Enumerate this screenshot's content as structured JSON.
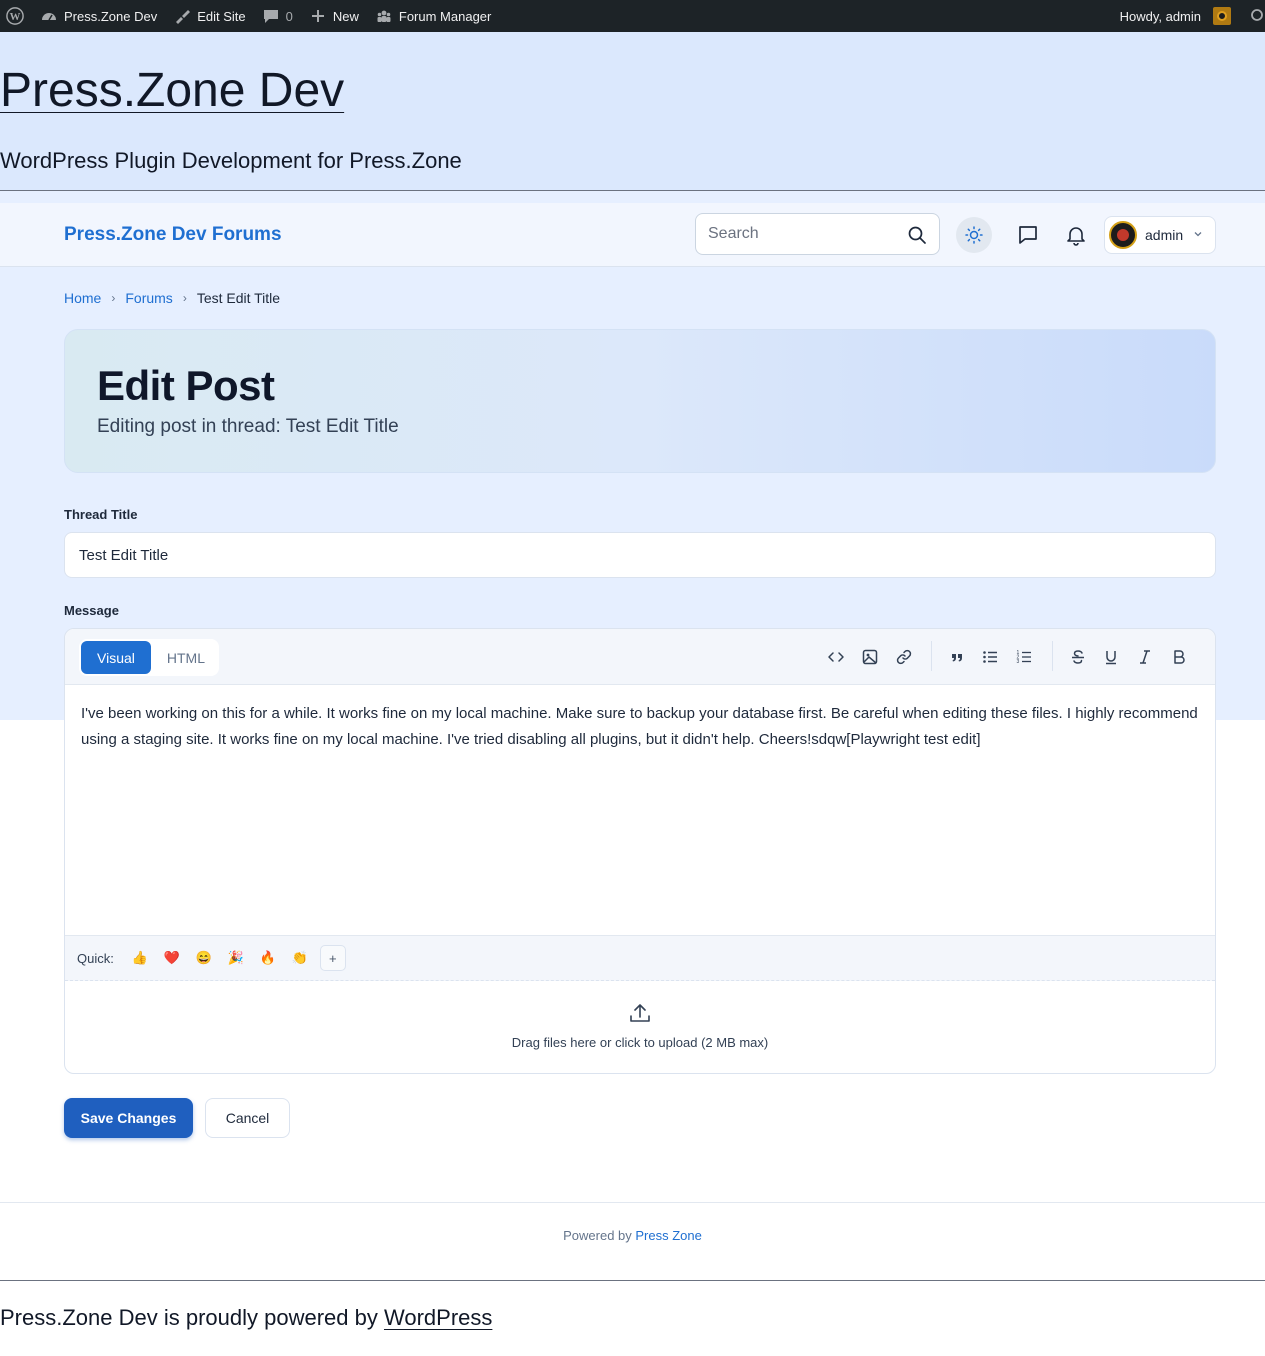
{
  "adminbar": {
    "site_name": "Press.Zone Dev",
    "edit_site": "Edit Site",
    "comments_count": "0",
    "new_label": "New",
    "forum_manager": "Forum Manager",
    "howdy": "Howdy, admin"
  },
  "site": {
    "title": "Press.Zone Dev",
    "description": "WordPress Plugin Development for Press.Zone"
  },
  "forum_header": {
    "brand": "Press.Zone Dev Forums",
    "search_placeholder": "Search",
    "user_name": "admin"
  },
  "breadcrumb": {
    "home": "Home",
    "forums": "Forums",
    "current": "Test Edit Title",
    "separator": "›"
  },
  "hero": {
    "title": "Edit Post",
    "subtitle": "Editing post in thread: Test Edit Title"
  },
  "form": {
    "thread_title_label": "Thread Title",
    "thread_title_value": "Test Edit Title",
    "message_label": "Message",
    "tabs": [
      "Visual",
      "HTML"
    ],
    "active_tab": "Visual",
    "body": "I've been working on this for a while. It works fine on my local machine. Make sure to backup your database first. Be careful when editing these files. I highly recommend using a staging site. It works fine on my local machine. I've tried disabling all plugins, but it didn't help. Cheers!sdqw[Playwright test edit]",
    "quick_label": "Quick:",
    "quick_emojis": [
      "👍",
      "❤️",
      "😄",
      "🎉",
      "🔥",
      "👏"
    ],
    "quick_more": "+",
    "dropzone_text": "Drag files here or click to upload (2 MB max)",
    "save_label": "Save Changes",
    "cancel_label": "Cancel"
  },
  "forum_footer": {
    "powered_prefix": "Powered by",
    "powered_link": "Press Zone"
  },
  "site_footer": {
    "text": "Press.Zone Dev is proudly powered by",
    "link": "WordPress"
  },
  "colors": {
    "accent": "#1f6fd1",
    "adminbar": "#1d2327",
    "page_bg": "#e6efff"
  }
}
